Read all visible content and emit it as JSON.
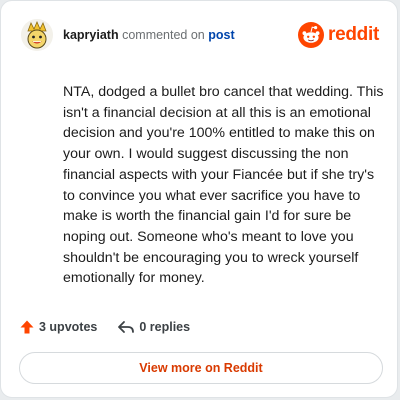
{
  "comment": {
    "username": "kapryiath",
    "action_text": "commented on",
    "target_link": "post",
    "body": "NTA, dodged a bullet bro cancel that wedding. This isn't a financial decision at all this is an emotional decision and you're 100% entitled to make this on your own. I would suggest discussing the non financial aspects with your Fiancée but if she try's to convince you what ever sacrifice you have to make is worth the financial gain I'd for sure be noping out. Someone who's meant to love you shouldn't be encouraging you to wreck yourself emotionally for money.",
    "upvotes_label": "3 upvotes",
    "replies_label": "0 replies"
  },
  "brand": {
    "wordmark": "reddit",
    "logo_icon": "reddit-snoo-icon",
    "color": "#ff4500"
  },
  "icons": {
    "upvote": "upvote-arrow-icon",
    "reply": "reply-arrow-icon",
    "avatar": "user-avatar"
  },
  "actions": {
    "view_more_label": "View more on Reddit"
  },
  "colors": {
    "link_blue": "#0045ac",
    "upvote_orange": "#ff4500",
    "button_text": "#d93a00"
  }
}
